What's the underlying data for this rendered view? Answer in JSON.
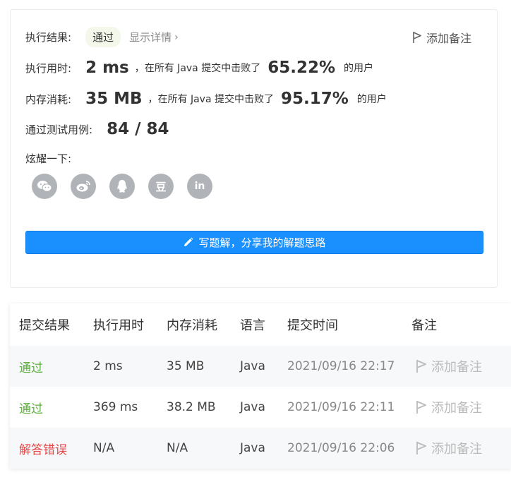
{
  "result": {
    "label": "执行结果:",
    "status": "通过",
    "details_link": "显示详情",
    "details_chevron": "›",
    "add_note": "添加备注"
  },
  "runtime": {
    "label": "执行用时:",
    "value": "2 ms",
    "beat_text": "，在所有 Java 提交中击败了",
    "percent": "65.22%",
    "suffix": "的用户"
  },
  "memory": {
    "label": "内存消耗:",
    "value": "35 MB",
    "beat_text": "，在所有 Java 提交中击败了",
    "percent": "95.17%",
    "suffix": "的用户"
  },
  "tests": {
    "label": "通过测试用例:",
    "value": "84 / 84"
  },
  "share": {
    "label": "炫耀一下:",
    "icons": [
      "wechat-icon",
      "weibo-icon",
      "qq-icon",
      "douban-icon",
      "linkedin-icon"
    ],
    "douban_glyph": "豆",
    "linkedin_glyph": "in"
  },
  "write_solution_button": "写题解，分享我的解题思路",
  "table": {
    "headers": [
      "提交结果",
      "执行用时",
      "内存消耗",
      "语言",
      "提交时间",
      "备注"
    ],
    "rows": [
      {
        "status": "通过",
        "runtime": "2 ms",
        "memory": "35 MB",
        "language": "Java",
        "time": "2021/09/16 22:17",
        "note": "添加备注"
      },
      {
        "status": "通过",
        "runtime": "369 ms",
        "memory": "38.2 MB",
        "language": "Java",
        "time": "2021/09/16 22:11",
        "note": "添加备注"
      },
      {
        "status": "解答错误",
        "runtime": "N/A",
        "memory": "N/A",
        "language": "Java",
        "time": "2021/09/16 22:06",
        "note": "添加备注"
      }
    ]
  },
  "colors": {
    "accent": "#1a90ff",
    "pass": "#5cb03c",
    "error": "#e64545",
    "share_icon": "#b0b3b8"
  }
}
